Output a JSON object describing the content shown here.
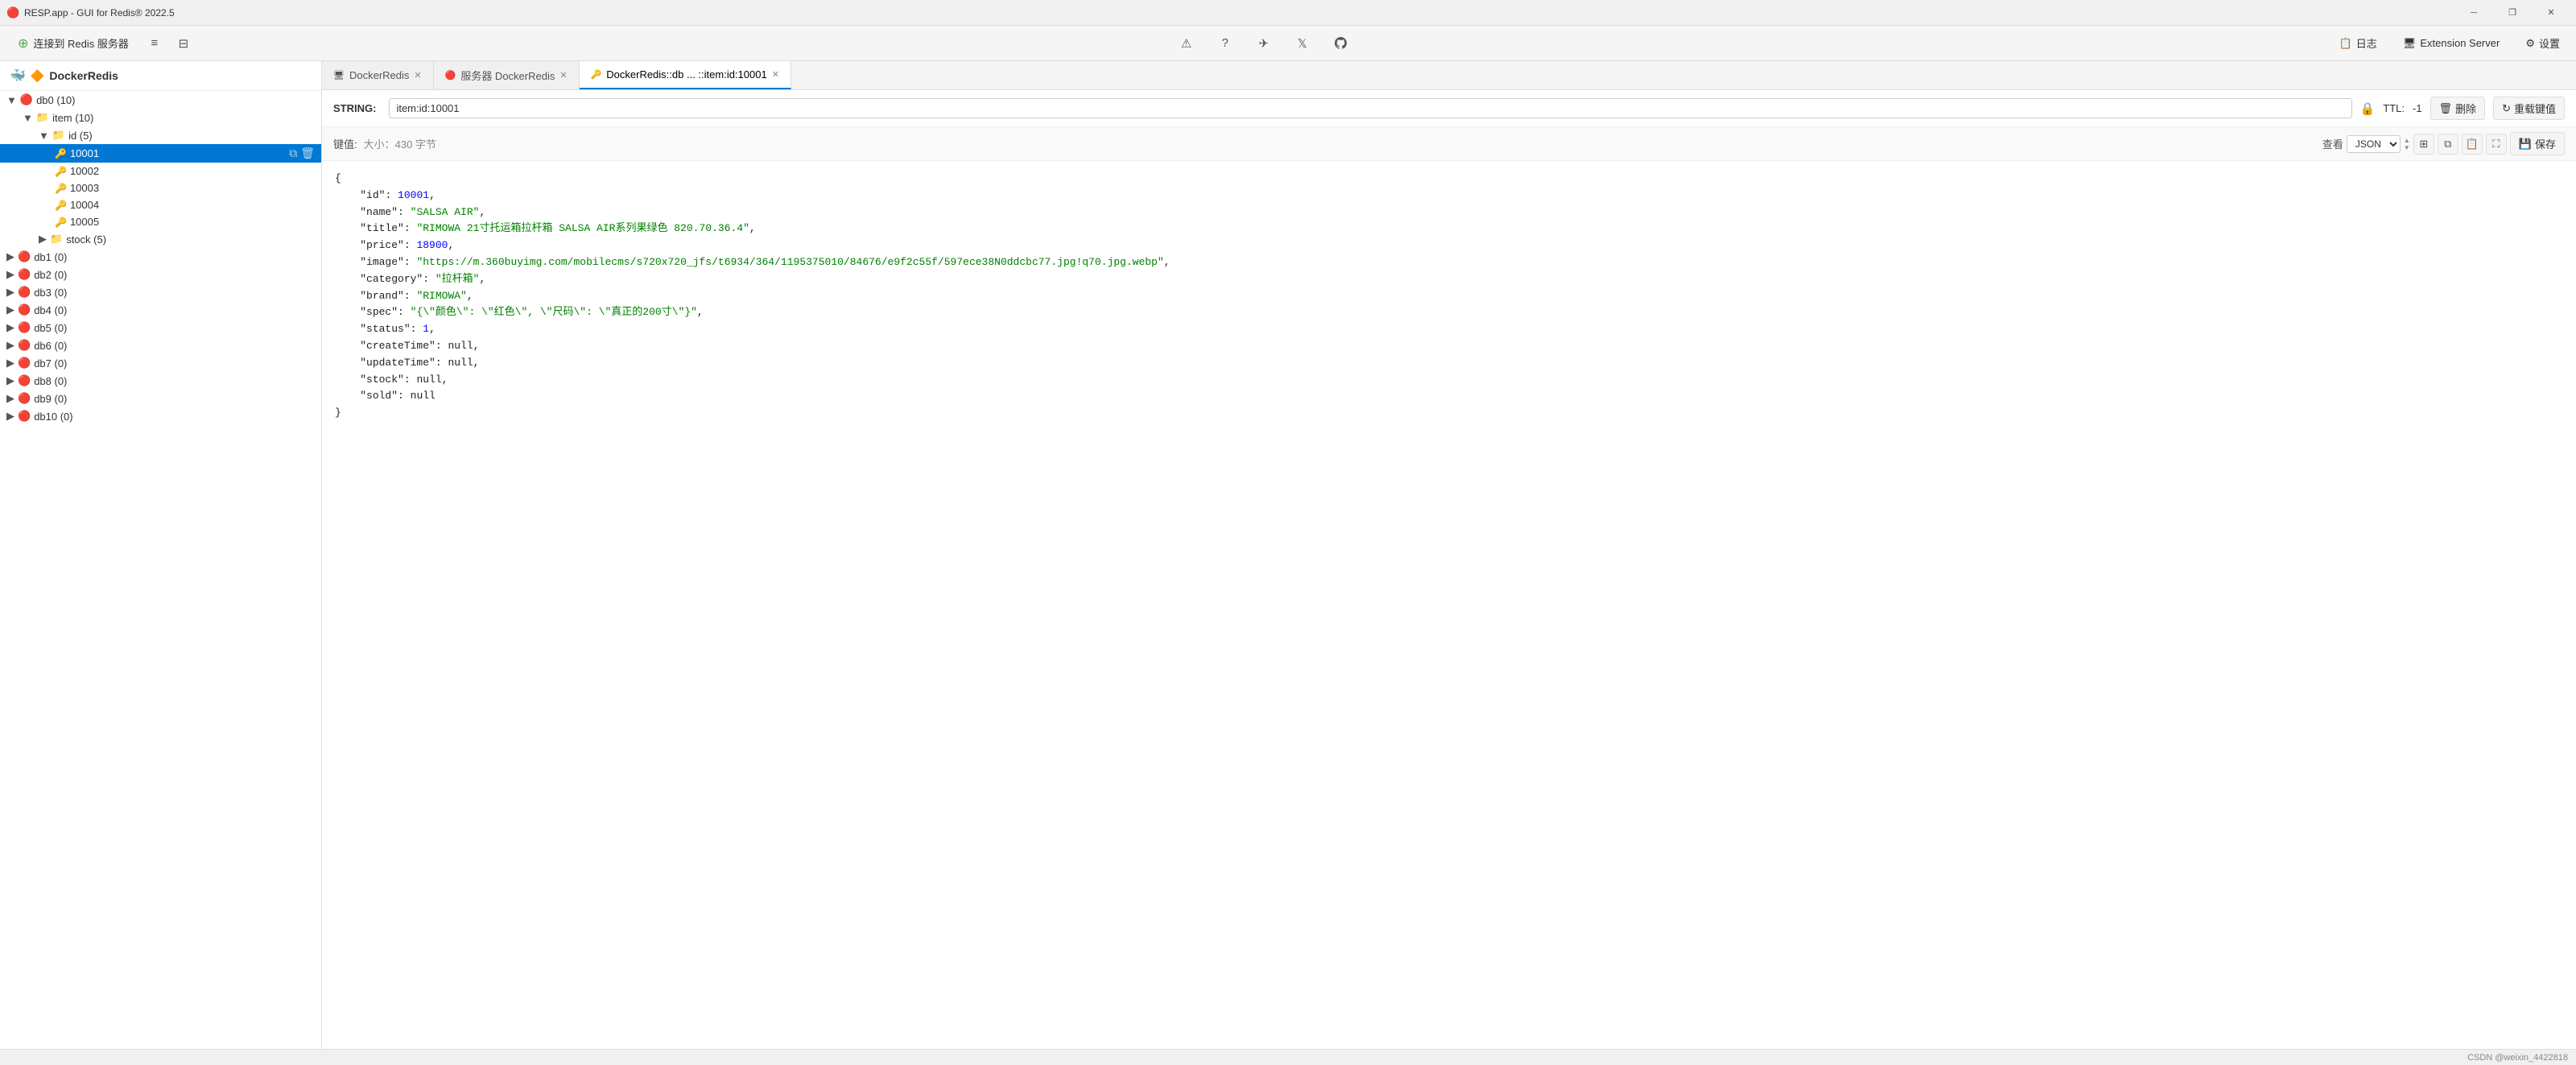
{
  "app": {
    "title": "RESP.app - GUI for Redis® 2022.5",
    "icon": "🔴"
  },
  "titlebar": {
    "title": "RESP.app - GUI for Redis® 2022.5",
    "minimize_label": "─",
    "restore_label": "❐",
    "close_label": "✕"
  },
  "toolbar": {
    "connect_label": "连接到 Redis 服务器",
    "list_icon": "≡",
    "layout_icon": "⊟",
    "warning_icon": "⚠",
    "question_icon": "?",
    "telegram_icon": "✈",
    "twitter_icon": "🐦",
    "github_icon": "⚙",
    "log_label": "日志",
    "extension_server_label": "Extension Server",
    "settings_label": "设置"
  },
  "sidebar": {
    "root_label": "DockerRedis",
    "items": [
      {
        "label": "db0",
        "count": "(10)",
        "type": "db",
        "expanded": true,
        "level": 0
      },
      {
        "label": "item",
        "count": "(10)",
        "type": "folder",
        "expanded": true,
        "level": 1
      },
      {
        "label": "id",
        "count": "(5)",
        "type": "folder",
        "expanded": true,
        "level": 2
      },
      {
        "label": "10001",
        "type": "key",
        "level": 3,
        "selected": true
      },
      {
        "label": "10002",
        "type": "key",
        "level": 3
      },
      {
        "label": "10003",
        "type": "key",
        "level": 3
      },
      {
        "label": "10004",
        "type": "key",
        "level": 3
      },
      {
        "label": "10005",
        "type": "key",
        "level": 3
      },
      {
        "label": "stock",
        "count": "(5)",
        "type": "folder",
        "expanded": false,
        "level": 2
      },
      {
        "label": "db1",
        "count": "(0)",
        "type": "db",
        "level": 0
      },
      {
        "label": "db2",
        "count": "(0)",
        "type": "db",
        "level": 0
      },
      {
        "label": "db3",
        "count": "(0)",
        "type": "db",
        "level": 0
      },
      {
        "label": "db4",
        "count": "(0)",
        "type": "db",
        "level": 0
      },
      {
        "label": "db5",
        "count": "(0)",
        "type": "db",
        "level": 0
      },
      {
        "label": "db6",
        "count": "(0)",
        "type": "db",
        "level": 0
      },
      {
        "label": "db7",
        "count": "(0)",
        "type": "db",
        "level": 0
      },
      {
        "label": "db8",
        "count": "(0)",
        "type": "db",
        "level": 0
      },
      {
        "label": "db9",
        "count": "(0)",
        "type": "db",
        "level": 0
      },
      {
        "label": "db10",
        "count": "(0)",
        "type": "db",
        "level": 0
      }
    ]
  },
  "tabs": [
    {
      "label": "DockerRedis",
      "icon": "🖥",
      "closable": true,
      "active": false
    },
    {
      "label": "服务器 DockerRedis",
      "icon": "🔴",
      "closable": true,
      "active": false
    },
    {
      "label": "DockerRedis::db ... ::item:id:10001",
      "icon": "🔑",
      "closable": true,
      "active": true
    }
  ],
  "key_editor": {
    "type_badge": "STRING:",
    "key_value": "item:id:10001",
    "ttl_label": "TTL:",
    "ttl_value": "-1",
    "delete_label": "删除",
    "reload_label": "重载键值"
  },
  "value_bar": {
    "label": "键值:",
    "size_info": "大小：430 字节",
    "view_label": "查看",
    "format_label": "JSON",
    "save_label": "保存"
  },
  "json_content": {
    "raw": "{\n    \"id\": 10001,\n    \"name\": \"SALSA AIR\",\n    \"title\": \"RIMOWA 21寸托运箱拉杆箱 SALSA AIR系列果绿色 820.70.36.4\",\n    \"price\": 18900,\n    \"image\": \"https://m.360buyimg.com/mobilecms/s720x720_jfs/t6934/364/1195375010/84676/e9f2c55f/597ece38N0ddcbc77.jpg!q70.jpg.webp\",\n    \"category\": \"拉杆箱\",\n    \"brand\": \"RIMOWA\",\n    \"spec\": \"{\\\"颜色\\\": \\\"红色\\\", \\\"尺码\\\": \\\"真正的200寸\\\"}\",\n    \"status\": 1,\n    \"createTime\": null,\n    \"updateTime\": null,\n    \"stock\": null,\n    \"sold\": null\n}"
  },
  "statusbar": {
    "text": "CSDN @weixin_4422818"
  }
}
